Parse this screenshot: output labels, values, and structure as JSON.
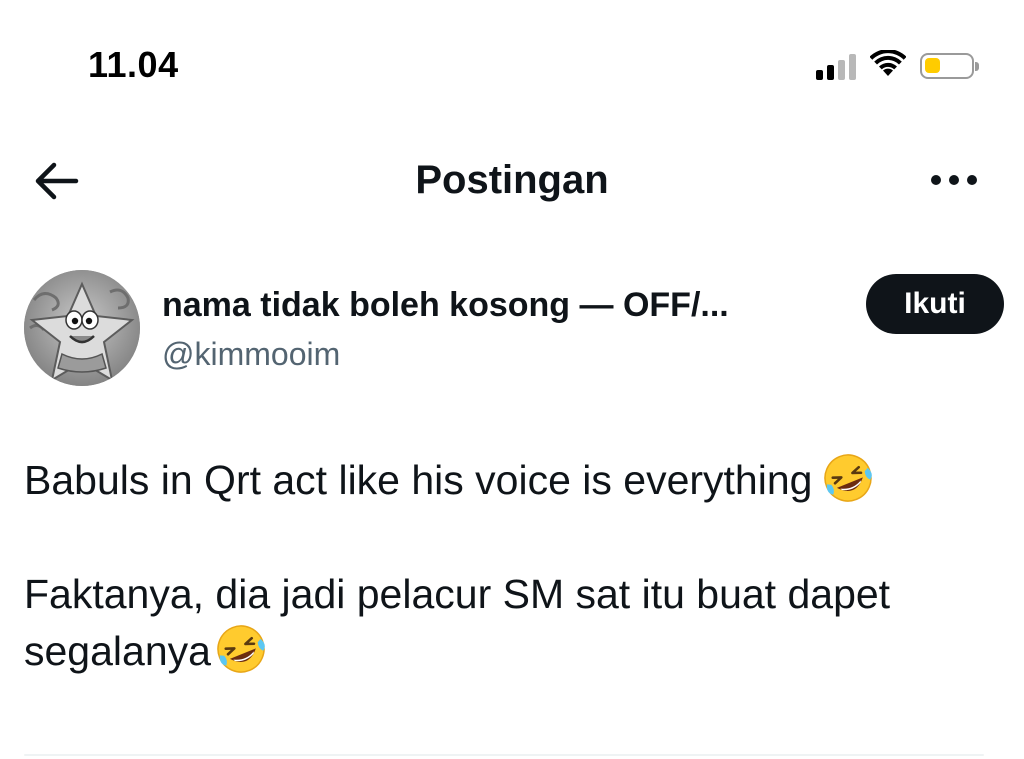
{
  "status_bar": {
    "time": "11.04",
    "icons": [
      "cellular-signal-icon",
      "wifi-icon",
      "battery-icon"
    ],
    "signal_bars_active": 2,
    "signal_bars_total": 4,
    "battery_level": 0.35,
    "battery_color": "#ffcc00"
  },
  "header": {
    "title": "Postingan",
    "back_icon": "back-arrow-icon",
    "more_icon": "more-options-icon"
  },
  "author": {
    "display_name": "nama tidak boleh kosong — OFF/...",
    "handle": "@kimmooim",
    "follow_label": "Ikuti",
    "avatar_icon": "avatar-patrick-star"
  },
  "post": {
    "paragraphs": [
      "Babuls in Qrt act like his voice is everything",
      "Faktanya, dia jadi pelacur SM sat itu buat dapet segalanya"
    ],
    "emoji": "rolling-on-floor-laughing-emoji"
  },
  "colors": {
    "text_primary": "#0f1419",
    "text_secondary": "#536471",
    "button_bg": "#0f1419",
    "button_text": "#ffffff",
    "divider": "#eff3f4"
  }
}
